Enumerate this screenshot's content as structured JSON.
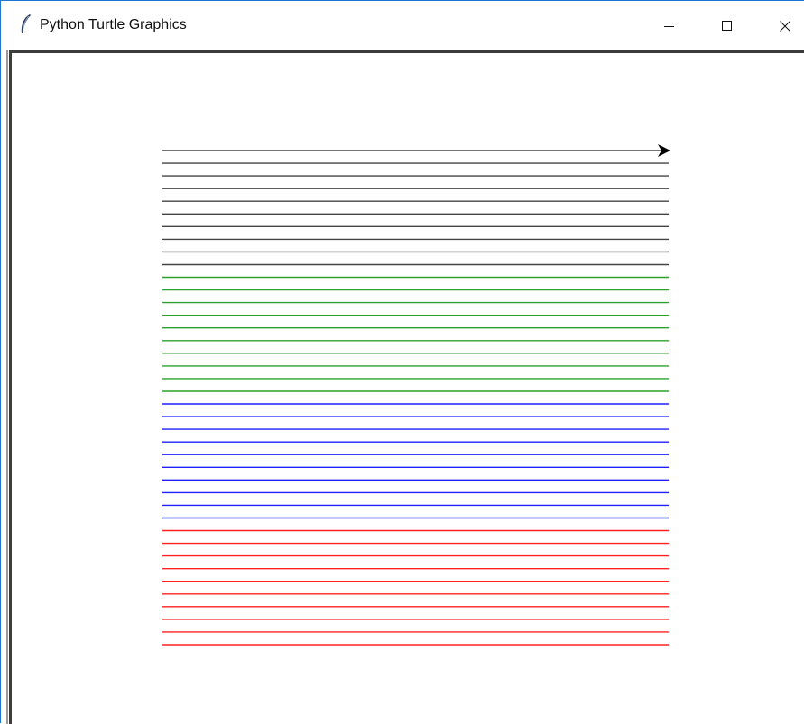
{
  "window": {
    "title": "Python Turtle Graphics",
    "icon": "feather-icon",
    "controls": {
      "minimize_icon": "minimize-icon",
      "maximize_icon": "maximize-icon",
      "close_icon": "close-icon"
    }
  },
  "drawing": {
    "turtle_shape": "arrow",
    "turtle_heading": "east",
    "bands": [
      {
        "color": "#444444",
        "count": 10
      },
      {
        "color": "#2ca02c",
        "count": 10
      },
      {
        "color": "#1f1fff",
        "count": 10
      },
      {
        "color": "#ff2020",
        "count": 10
      }
    ]
  }
}
